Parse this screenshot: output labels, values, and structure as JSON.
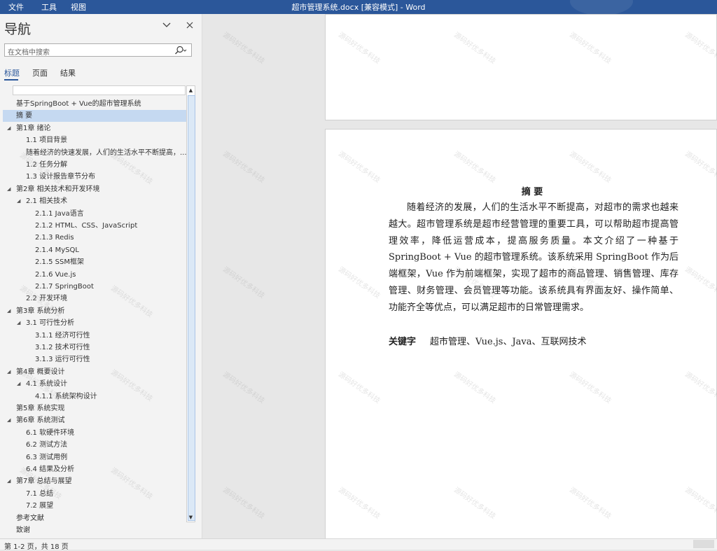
{
  "menu": [
    "文件",
    "工具",
    "视图"
  ],
  "window_title": "超市管理系统.docx [兼容模式] - Word",
  "nav": {
    "title": "导航",
    "search_placeholder": "在文档中搜索",
    "tabs": [
      "标题",
      "页面",
      "结果"
    ],
    "active_tab": 0,
    "items": [
      {
        "label": "基于SpringBoot + Vue的超市管理系统",
        "level": 1,
        "caret": false,
        "selected": false
      },
      {
        "label": "摘 要",
        "level": 1,
        "caret": false,
        "selected": true
      },
      {
        "label": "第1章 绪论",
        "level": 1,
        "caret": true,
        "selected": false
      },
      {
        "label": "1.1 项目背景",
        "level": 2,
        "caret": false,
        "selected": false
      },
      {
        "label": "随着经济的快速发展，人们的生活水平不断提高，...",
        "level": 2,
        "caret": false,
        "selected": false
      },
      {
        "label": "1.2 任务分解",
        "level": 2,
        "caret": false,
        "selected": false
      },
      {
        "label": "1.3 设计报告章节分布",
        "level": 2,
        "caret": false,
        "selected": false
      },
      {
        "label": "第2章 相关技术和开发环境",
        "level": 1,
        "caret": true,
        "selected": false
      },
      {
        "label": "2.1 相关技术",
        "level": 2,
        "caret": true,
        "selected": false
      },
      {
        "label": "2.1.1 Java语言",
        "level": 3,
        "caret": false,
        "selected": false
      },
      {
        "label": "2.1.2 HTML、CSS、JavaScript",
        "level": 3,
        "caret": false,
        "selected": false
      },
      {
        "label": "2.1.3 Redis",
        "level": 3,
        "caret": false,
        "selected": false
      },
      {
        "label": "2.1.4 MySQL",
        "level": 3,
        "caret": false,
        "selected": false
      },
      {
        "label": "2.1.5 SSM框架",
        "level": 3,
        "caret": false,
        "selected": false
      },
      {
        "label": "2.1.6 Vue.js",
        "level": 3,
        "caret": false,
        "selected": false
      },
      {
        "label": "2.1.7 SpringBoot",
        "level": 3,
        "caret": false,
        "selected": false
      },
      {
        "label": "2.2 开发环境",
        "level": 2,
        "caret": false,
        "selected": false
      },
      {
        "label": "第3章 系统分析",
        "level": 1,
        "caret": true,
        "selected": false
      },
      {
        "label": "3.1 可行性分析",
        "level": 2,
        "caret": true,
        "selected": false
      },
      {
        "label": "3.1.1 经济可行性",
        "level": 3,
        "caret": false,
        "selected": false
      },
      {
        "label": "3.1.2 技术可行性",
        "level": 3,
        "caret": false,
        "selected": false
      },
      {
        "label": "3.1.3 运行可行性",
        "level": 3,
        "caret": false,
        "selected": false
      },
      {
        "label": "第4章 概要设计",
        "level": 1,
        "caret": true,
        "selected": false
      },
      {
        "label": "4.1 系统设计",
        "level": 2,
        "caret": true,
        "selected": false
      },
      {
        "label": "4.1.1 系统架构设计",
        "level": 3,
        "caret": false,
        "selected": false
      },
      {
        "label": "第5章 系统实现",
        "level": 1,
        "caret": false,
        "selected": false
      },
      {
        "label": "第6章 系统测试",
        "level": 1,
        "caret": true,
        "selected": false
      },
      {
        "label": "6.1 软硬件环境",
        "level": 2,
        "caret": false,
        "selected": false
      },
      {
        "label": "6.2 测试方法",
        "level": 2,
        "caret": false,
        "selected": false
      },
      {
        "label": "6.3 测试用例",
        "level": 2,
        "caret": false,
        "selected": false
      },
      {
        "label": "6.4 结果及分析",
        "level": 2,
        "caret": false,
        "selected": false
      },
      {
        "label": "第7章 总结与展望",
        "level": 1,
        "caret": true,
        "selected": false
      },
      {
        "label": "7.1 总结",
        "level": 2,
        "caret": false,
        "selected": false
      },
      {
        "label": "7.2 展望",
        "level": 2,
        "caret": false,
        "selected": false
      },
      {
        "label": "参考文献",
        "level": 1,
        "caret": false,
        "selected": false
      },
      {
        "label": "致谢",
        "level": 1,
        "caret": false,
        "selected": false
      }
    ]
  },
  "document": {
    "abstract_title": "摘 要",
    "abstract_body": "随着经济的发展，人们的生活水平不断提高，对超市的需求也越来越大。超市管理系统是超市经营管理的重要工具，可以帮助超市提高管理效率，降低运营成本，提高服务质量。本文介绍了一种基于 SpringBoot + Vue 的超市管理系统。该系统采用 SpringBoot 作为后端框架，Vue 作为前端框架，实现了超市的商品管理、销售管理、库存管理、财务管理、会员管理等功能。该系统具有界面友好、操作简单、功能齐全等优点，可以满足超市的日常管理需求。",
    "keywords_label": "关键字",
    "keywords": "超市管理、Vue.js、Java、互联网技术"
  },
  "watermark": "源码好优多科技",
  "status": {
    "pages": "第 1-2 页，共 18 页"
  },
  "colors": {
    "accent": "#2b579a",
    "selection": "#c5d9f1"
  }
}
